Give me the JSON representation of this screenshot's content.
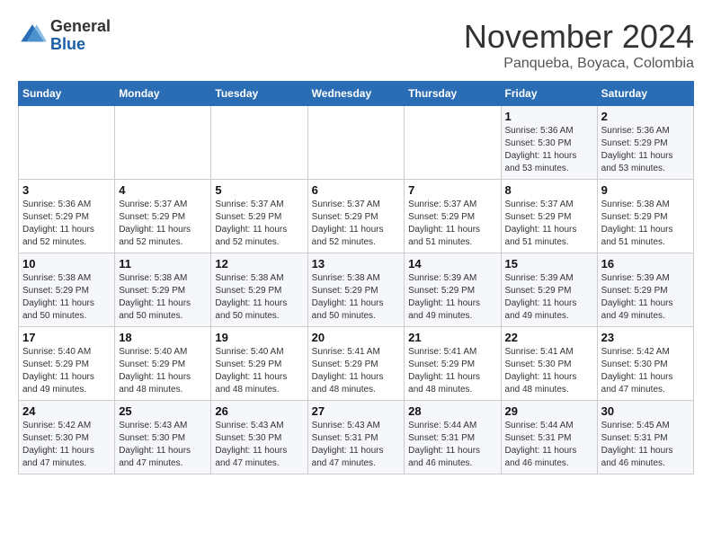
{
  "header": {
    "logo_line1": "General",
    "logo_line2": "Blue",
    "month": "November 2024",
    "location": "Panqueba, Boyaca, Colombia"
  },
  "weekdays": [
    "Sunday",
    "Monday",
    "Tuesday",
    "Wednesday",
    "Thursday",
    "Friday",
    "Saturday"
  ],
  "weeks": [
    [
      {
        "day": "",
        "info": ""
      },
      {
        "day": "",
        "info": ""
      },
      {
        "day": "",
        "info": ""
      },
      {
        "day": "",
        "info": ""
      },
      {
        "day": "",
        "info": ""
      },
      {
        "day": "1",
        "info": "Sunrise: 5:36 AM\nSunset: 5:30 PM\nDaylight: 11 hours and 53 minutes."
      },
      {
        "day": "2",
        "info": "Sunrise: 5:36 AM\nSunset: 5:29 PM\nDaylight: 11 hours and 53 minutes."
      }
    ],
    [
      {
        "day": "3",
        "info": "Sunrise: 5:36 AM\nSunset: 5:29 PM\nDaylight: 11 hours and 52 minutes."
      },
      {
        "day": "4",
        "info": "Sunrise: 5:37 AM\nSunset: 5:29 PM\nDaylight: 11 hours and 52 minutes."
      },
      {
        "day": "5",
        "info": "Sunrise: 5:37 AM\nSunset: 5:29 PM\nDaylight: 11 hours and 52 minutes."
      },
      {
        "day": "6",
        "info": "Sunrise: 5:37 AM\nSunset: 5:29 PM\nDaylight: 11 hours and 52 minutes."
      },
      {
        "day": "7",
        "info": "Sunrise: 5:37 AM\nSunset: 5:29 PM\nDaylight: 11 hours and 51 minutes."
      },
      {
        "day": "8",
        "info": "Sunrise: 5:37 AM\nSunset: 5:29 PM\nDaylight: 11 hours and 51 minutes."
      },
      {
        "day": "9",
        "info": "Sunrise: 5:38 AM\nSunset: 5:29 PM\nDaylight: 11 hours and 51 minutes."
      }
    ],
    [
      {
        "day": "10",
        "info": "Sunrise: 5:38 AM\nSunset: 5:29 PM\nDaylight: 11 hours and 50 minutes."
      },
      {
        "day": "11",
        "info": "Sunrise: 5:38 AM\nSunset: 5:29 PM\nDaylight: 11 hours and 50 minutes."
      },
      {
        "day": "12",
        "info": "Sunrise: 5:38 AM\nSunset: 5:29 PM\nDaylight: 11 hours and 50 minutes."
      },
      {
        "day": "13",
        "info": "Sunrise: 5:38 AM\nSunset: 5:29 PM\nDaylight: 11 hours and 50 minutes."
      },
      {
        "day": "14",
        "info": "Sunrise: 5:39 AM\nSunset: 5:29 PM\nDaylight: 11 hours and 49 minutes."
      },
      {
        "day": "15",
        "info": "Sunrise: 5:39 AM\nSunset: 5:29 PM\nDaylight: 11 hours and 49 minutes."
      },
      {
        "day": "16",
        "info": "Sunrise: 5:39 AM\nSunset: 5:29 PM\nDaylight: 11 hours and 49 minutes."
      }
    ],
    [
      {
        "day": "17",
        "info": "Sunrise: 5:40 AM\nSunset: 5:29 PM\nDaylight: 11 hours and 49 minutes."
      },
      {
        "day": "18",
        "info": "Sunrise: 5:40 AM\nSunset: 5:29 PM\nDaylight: 11 hours and 48 minutes."
      },
      {
        "day": "19",
        "info": "Sunrise: 5:40 AM\nSunset: 5:29 PM\nDaylight: 11 hours and 48 minutes."
      },
      {
        "day": "20",
        "info": "Sunrise: 5:41 AM\nSunset: 5:29 PM\nDaylight: 11 hours and 48 minutes."
      },
      {
        "day": "21",
        "info": "Sunrise: 5:41 AM\nSunset: 5:29 PM\nDaylight: 11 hours and 48 minutes."
      },
      {
        "day": "22",
        "info": "Sunrise: 5:41 AM\nSunset: 5:30 PM\nDaylight: 11 hours and 48 minutes."
      },
      {
        "day": "23",
        "info": "Sunrise: 5:42 AM\nSunset: 5:30 PM\nDaylight: 11 hours and 47 minutes."
      }
    ],
    [
      {
        "day": "24",
        "info": "Sunrise: 5:42 AM\nSunset: 5:30 PM\nDaylight: 11 hours and 47 minutes."
      },
      {
        "day": "25",
        "info": "Sunrise: 5:43 AM\nSunset: 5:30 PM\nDaylight: 11 hours and 47 minutes."
      },
      {
        "day": "26",
        "info": "Sunrise: 5:43 AM\nSunset: 5:30 PM\nDaylight: 11 hours and 47 minutes."
      },
      {
        "day": "27",
        "info": "Sunrise: 5:43 AM\nSunset: 5:31 PM\nDaylight: 11 hours and 47 minutes."
      },
      {
        "day": "28",
        "info": "Sunrise: 5:44 AM\nSunset: 5:31 PM\nDaylight: 11 hours and 46 minutes."
      },
      {
        "day": "29",
        "info": "Sunrise: 5:44 AM\nSunset: 5:31 PM\nDaylight: 11 hours and 46 minutes."
      },
      {
        "day": "30",
        "info": "Sunrise: 5:45 AM\nSunset: 5:31 PM\nDaylight: 11 hours and 46 minutes."
      }
    ]
  ]
}
